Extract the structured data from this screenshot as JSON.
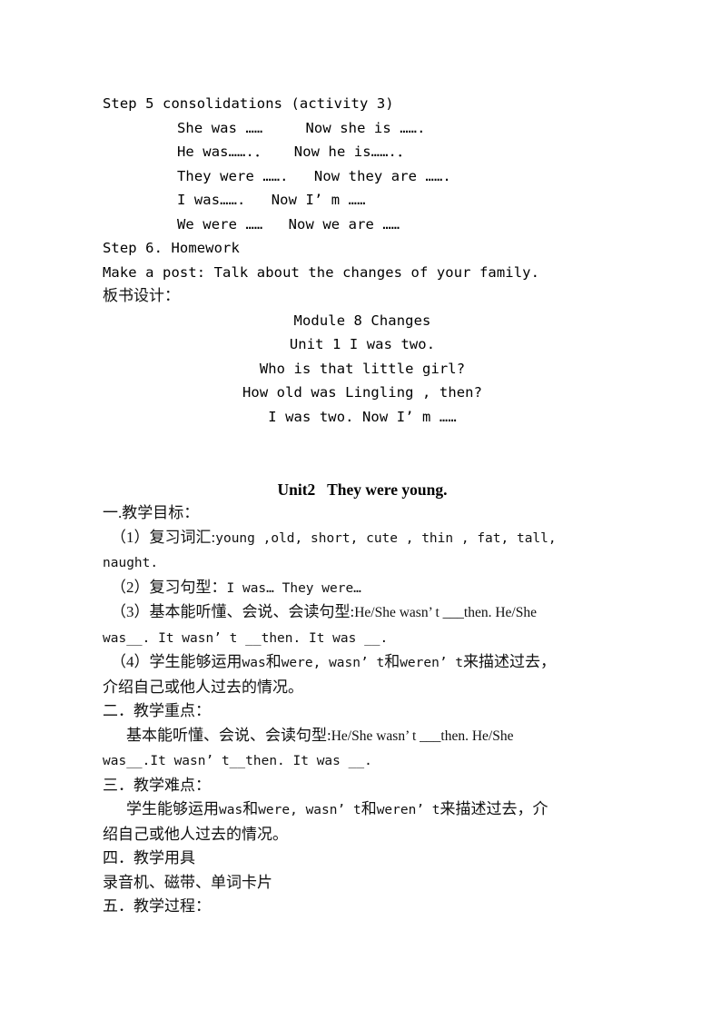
{
  "document": {
    "background_color": "#ffffff",
    "text_color": "#000000",
    "chinese_text_color": "#111111"
  },
  "step5": {
    "heading": "Step 5 consolidations (activity 3)",
    "lines": [
      "She was ……     Now she is …….",
      "He was…….．   Now he is…….．",
      "They were …….   Now they are …….",
      "I was…….   Now I’ m ……",
      "We were ……   Now we are ……"
    ]
  },
  "step6": {
    "heading": "Step 6. Homework",
    "body": "Make a post: Talk about the changes of your family."
  },
  "blackboard": {
    "label": "板书设计：",
    "lines": [
      "Module 8 Changes",
      "Unit 1 I was two.",
      "Who is that little girl?",
      "How old was Lingling , then?",
      "I was two. Now I’ m ……"
    ]
  },
  "unit2": {
    "title": "Unit2   They were young.",
    "section1": {
      "heading": "一.教学目标：",
      "item1_label": "（1）复习词汇:",
      "item1_value": "young ,old,  short,  cute ,  thin ,  fat, tall,",
      "item1_cont": "naught.",
      "item2_label": "（2）复习句型：",
      "item2_value": "I was…     They were…",
      "item3_label": "（3）基本能听懂、会说、会读句型:",
      "item3_value": "He/She wasn’ t ___then. He/She",
      "item3_cont": "was__.  It wasn’ t __then.  It was __.",
      "item4_part1": "（4）学生能够运用",
      "item4_en1": "was",
      "item4_part2": "和",
      "item4_en2": "were, wasn’ t",
      "item4_part3": "和",
      "item4_en3": "weren’ t",
      "item4_part4": "来描述过去，",
      "item4_cont": "介绍自己或他人过去的情况。"
    },
    "section2": {
      "heading": "二．教学重点：",
      "body_label": "基本能听懂、会说、会读句型:",
      "body_value": "He/She wasn’ t ___then.  He/She",
      "body_cont": "was__.It wasn’ t__then.  It was __."
    },
    "section3": {
      "heading": "三．教学难点：",
      "body_part1": "学生能够运用",
      "body_en1": "was",
      "body_part2": "和",
      "body_en2": "were, wasn’ t",
      "body_part3": "和",
      "body_en3": "weren’ t",
      "body_part4": "来描述过去，介",
      "body_cont": "绍自己或他人过去的情况。"
    },
    "section4": {
      "heading": "四．教学用具",
      "body": "录音机、磁带、单词卡片"
    },
    "section5": {
      "heading": "五．教学过程："
    }
  }
}
